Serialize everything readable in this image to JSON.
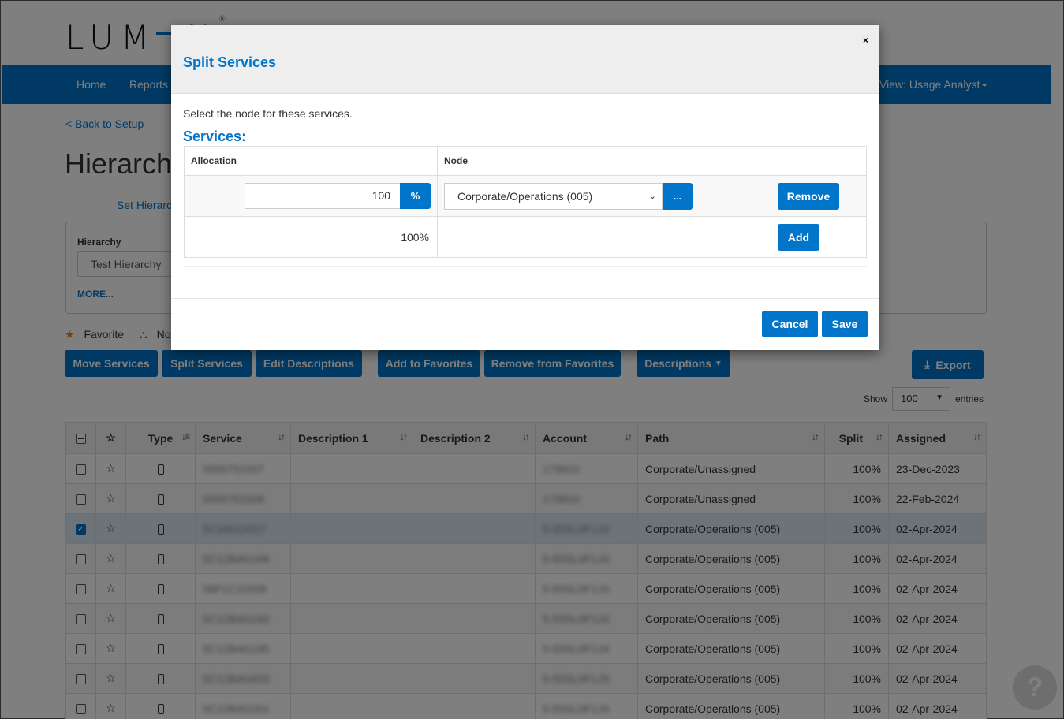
{
  "brand": {
    "logo_text_left": "LUM",
    "logo_text_right": "N",
    "registered": "®",
    "accent": "#0075c9"
  },
  "nav": {
    "home": "Home",
    "reports": "Reports",
    "view": "View: Usage Analyst"
  },
  "page": {
    "back_link": "< Back to Setup",
    "title": "Hierarchy",
    "set_hierarchy_link": "Set Hierarchy",
    "filter": {
      "label": "Hierarchy",
      "value": "Test Hierarchy",
      "more": "MORE..."
    },
    "legend": {
      "favorite": "Favorite",
      "node": "Node"
    }
  },
  "toolbar": {
    "move": "Move Services",
    "split": "Split Services",
    "edit_desc": "Edit Descriptions",
    "add_fav": "Add to Favorites",
    "remove_fav": "Remove from Favorites",
    "descriptions": "Descriptions",
    "export": "Export"
  },
  "entries": {
    "show": "Show",
    "value": "100",
    "suffix": "entries"
  },
  "table": {
    "columns": [
      "Type",
      "Service",
      "Description 1",
      "Description 2",
      "Account",
      "Path",
      "Split",
      "Assigned"
    ],
    "rows": [
      {
        "checked": false,
        "service": "5550751507",
        "desc1": "",
        "desc2": "",
        "account": "179910",
        "path": "Corporate/Unassigned",
        "split": "100%",
        "assigned": "23-Dec-2023"
      },
      {
        "checked": false,
        "service": "5550751528",
        "desc1": "",
        "desc2": "",
        "account": "179910",
        "path": "Corporate/Unassigned",
        "split": "100%",
        "assigned": "22-Feb-2024"
      },
      {
        "checked": true,
        "service": "5C34510027",
        "desc1": "",
        "desc2": "",
        "account": "5-55SL0F1JX",
        "path": "Corporate/Operations (005)",
        "split": "100%",
        "assigned": "02-Apr-2024"
      },
      {
        "checked": false,
        "service": "5C12B4G106",
        "desc1": "",
        "desc2": "",
        "account": "5-55SL0F1JX",
        "path": "Corporate/Operations (005)",
        "split": "100%",
        "assigned": "02-Apr-2024"
      },
      {
        "checked": false,
        "service": "58F1C10208",
        "desc1": "",
        "desc2": "",
        "account": "5-55SL0F1JX",
        "path": "Corporate/Operations (005)",
        "split": "100%",
        "assigned": "02-Apr-2024"
      },
      {
        "checked": false,
        "service": "5C12B4G192",
        "desc1": "",
        "desc2": "",
        "account": "5-55SL0F1JX",
        "path": "Corporate/Operations (005)",
        "split": "100%",
        "assigned": "02-Apr-2024"
      },
      {
        "checked": false,
        "service": "5C12B4G195",
        "desc1": "",
        "desc2": "",
        "account": "5-55SL0F1JX",
        "path": "Corporate/Operations (005)",
        "split": "100%",
        "assigned": "02-Apr-2024"
      },
      {
        "checked": false,
        "service": "5C12B4G833",
        "desc1": "",
        "desc2": "",
        "account": "5-55SL0F1JX",
        "path": "Corporate/Operations (005)",
        "split": "100%",
        "assigned": "02-Apr-2024"
      },
      {
        "checked": false,
        "service": "5C12B4G201",
        "desc1": "",
        "desc2": "",
        "account": "5-55SL0F1JX",
        "path": "Corporate/Operations (005)",
        "split": "100%",
        "assigned": "02-Apr-2024"
      }
    ]
  },
  "help": {
    "label": "?"
  },
  "modal": {
    "title": "Split Services",
    "close": "×",
    "description": "Select the node for these services.",
    "subtitle": "Services:",
    "headers": {
      "allocation": "Allocation",
      "node": "Node",
      "actions": ""
    },
    "row": {
      "allocation": "100",
      "unit": "%",
      "node": "Corporate/Operations (005)",
      "browse": "...",
      "remove": "Remove"
    },
    "total": "100%",
    "add": "Add",
    "cancel": "Cancel",
    "save": "Save"
  }
}
